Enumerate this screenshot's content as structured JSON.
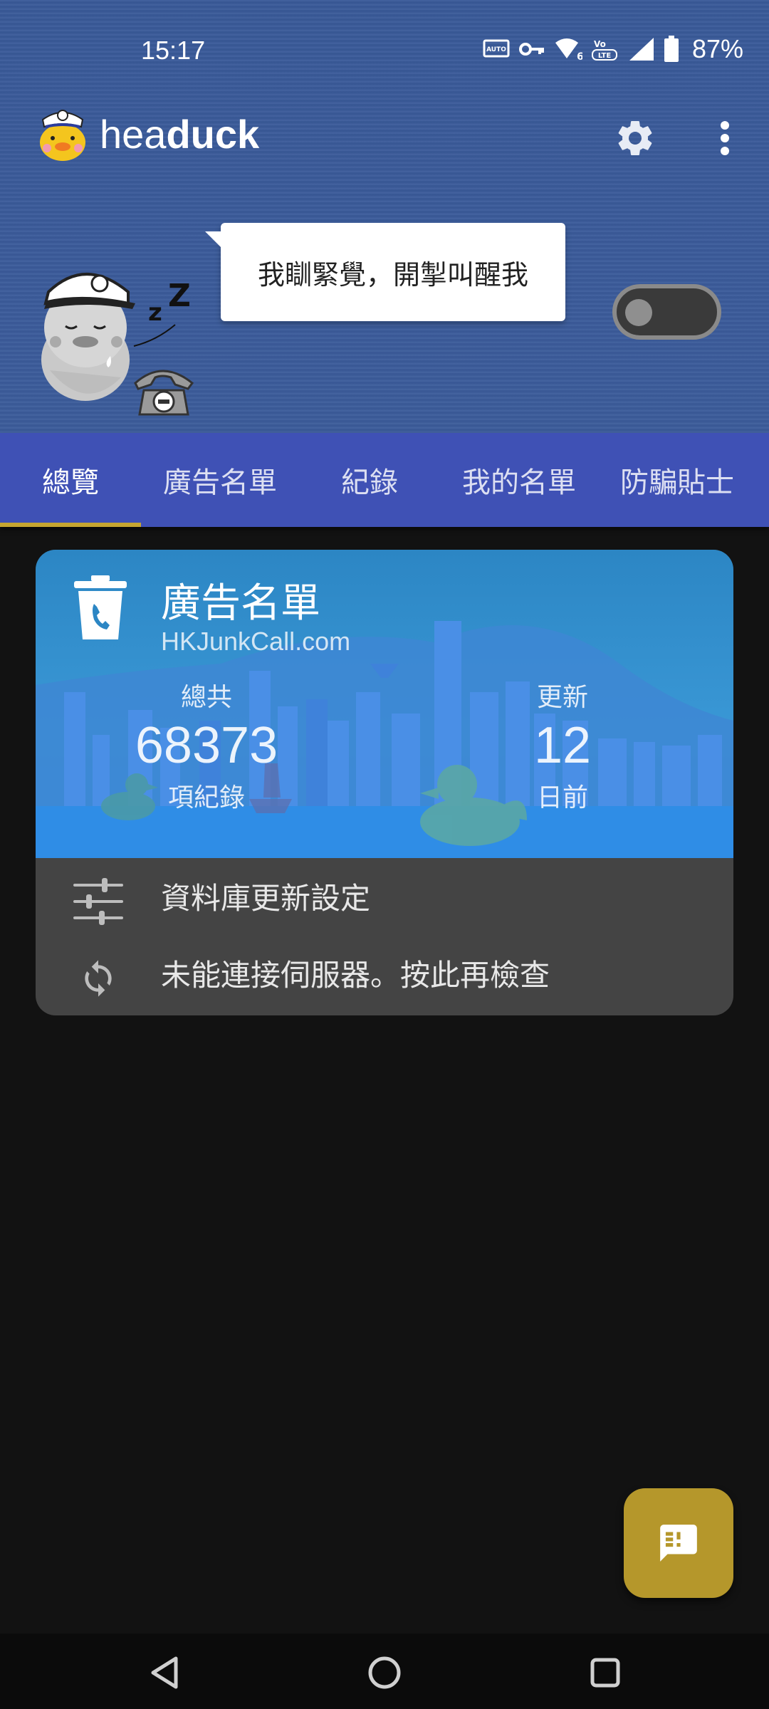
{
  "status_bar": {
    "time": "15:17",
    "battery_percent": "87%",
    "icons": [
      "auto-hz-icon",
      "vpn-key-icon",
      "wifi-6-icon",
      "volte-icon",
      "signal-icon",
      "battery-icon"
    ]
  },
  "app": {
    "title_regular": "hea",
    "title_bold": "duck",
    "actions": [
      "settings-icon",
      "more-vert-icon"
    ]
  },
  "hero": {
    "bubble_text": "我瞓緊覺，開掣叫醒我",
    "toggle_on": false
  },
  "tabs": [
    {
      "label": "總覽",
      "active": true
    },
    {
      "label": "廣告名單",
      "active": false
    },
    {
      "label": "紀錄",
      "active": false
    },
    {
      "label": "我的名單",
      "active": false
    },
    {
      "label": "防騙貼士",
      "active": false
    }
  ],
  "card": {
    "title": "廣告名單",
    "subtitle": "HKJunkCall.com",
    "total": {
      "label": "總共",
      "value": "68373",
      "unit": "項紀錄"
    },
    "update": {
      "label": "更新",
      "value": "12",
      "unit": "日前"
    },
    "rows": [
      {
        "icon": "sliders-icon",
        "label": "資料庫更新設定"
      },
      {
        "icon": "sync-icon",
        "label": "未能連接伺服器。按此再檢查"
      }
    ]
  },
  "fab": {
    "icon": "feedback-icon"
  },
  "nav": [
    "back-icon",
    "home-icon",
    "recents-icon"
  ],
  "colors": {
    "header_bg": "#3a5b9a",
    "tab_bar": "#3f51b5",
    "tab_indicator": "#c5a531",
    "fab": "#b5972b",
    "card_banner": "#3a98d6",
    "card_body": "#444444"
  }
}
